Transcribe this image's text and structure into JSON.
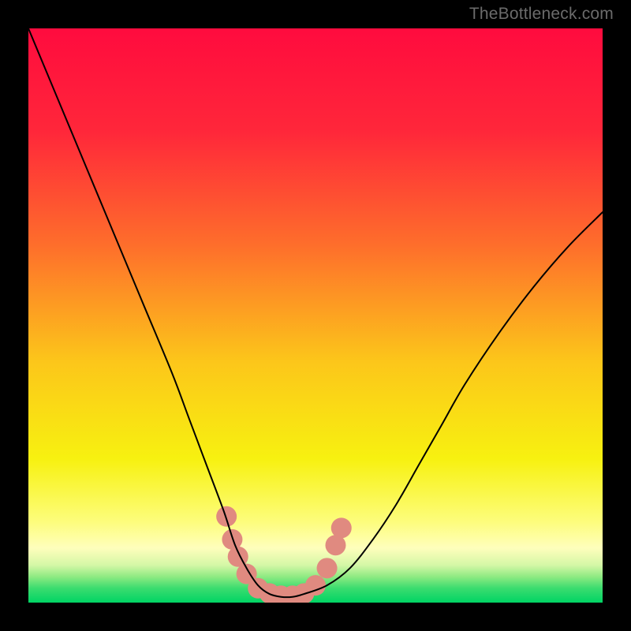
{
  "watermark": "TheBottleneck.com",
  "chart_data": {
    "type": "line",
    "title": "",
    "xlabel": "",
    "ylabel": "",
    "xlim": [
      0,
      100
    ],
    "ylim": [
      0,
      100
    ],
    "grid": false,
    "legend": false,
    "gradient_stops": [
      {
        "pos": 0.0,
        "color": "#ff0b3e"
      },
      {
        "pos": 0.18,
        "color": "#ff273a"
      },
      {
        "pos": 0.38,
        "color": "#fe6f2b"
      },
      {
        "pos": 0.58,
        "color": "#fcc61a"
      },
      {
        "pos": 0.75,
        "color": "#f7f110"
      },
      {
        "pos": 0.86,
        "color": "#fdfd7d"
      },
      {
        "pos": 0.905,
        "color": "#fefebc"
      },
      {
        "pos": 0.935,
        "color": "#d4f7a6"
      },
      {
        "pos": 0.955,
        "color": "#8eea82"
      },
      {
        "pos": 0.975,
        "color": "#3bdc6f"
      },
      {
        "pos": 1.0,
        "color": "#00d464"
      }
    ],
    "series": [
      {
        "name": "bottleneck-curve",
        "x": [
          0,
          5,
          10,
          15,
          20,
          25,
          28,
          31,
          34,
          36,
          38,
          40,
          42,
          44,
          46,
          48,
          52,
          56,
          60,
          64,
          68,
          72,
          76,
          82,
          88,
          94,
          100
        ],
        "y": [
          100,
          88,
          76,
          64,
          52,
          40,
          32,
          24,
          16,
          10,
          6,
          3,
          1.5,
          1,
          1,
          1.5,
          3,
          6,
          11,
          17,
          24,
          31,
          38,
          47,
          55,
          62,
          68
        ],
        "color": "#000000",
        "width": 2
      }
    ],
    "markers": {
      "name": "highlight-band",
      "color": "#e08a80",
      "points": [
        {
          "x": 34.5,
          "y": 15
        },
        {
          "x": 35.5,
          "y": 11
        },
        {
          "x": 36.5,
          "y": 8
        },
        {
          "x": 38.0,
          "y": 5
        },
        {
          "x": 40.0,
          "y": 2.5
        },
        {
          "x": 42.0,
          "y": 1.6
        },
        {
          "x": 44.0,
          "y": 1.2
        },
        {
          "x": 46.0,
          "y": 1.2
        },
        {
          "x": 48.0,
          "y": 1.6
        },
        {
          "x": 50.0,
          "y": 3.0
        },
        {
          "x": 52.0,
          "y": 6.0
        },
        {
          "x": 53.5,
          "y": 10.0
        },
        {
          "x": 54.5,
          "y": 13.0
        }
      ]
    }
  }
}
